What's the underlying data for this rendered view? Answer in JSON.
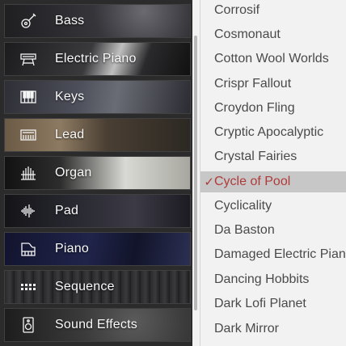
{
  "categories": [
    {
      "label": "Bass",
      "icon": "guitar-icon"
    },
    {
      "label": "Electric Piano",
      "icon": "electric-piano-icon"
    },
    {
      "label": "Keys",
      "icon": "keys-icon"
    },
    {
      "label": "Lead",
      "icon": "lead-synth-icon"
    },
    {
      "label": "Organ",
      "icon": "organ-icon"
    },
    {
      "label": "Pad",
      "icon": "waveform-icon"
    },
    {
      "label": "Piano",
      "icon": "grand-piano-icon"
    },
    {
      "label": "Sequence",
      "icon": "sequence-grid-icon"
    },
    {
      "label": "Sound Effects",
      "icon": "speaker-icon"
    }
  ],
  "presets": [
    {
      "name": "Corrosif"
    },
    {
      "name": "Cosmonaut"
    },
    {
      "name": "Cotton Wool Worlds"
    },
    {
      "name": "Crispr Fallout"
    },
    {
      "name": "Croydon Fling"
    },
    {
      "name": "Cryptic Apocalyptic"
    },
    {
      "name": "Crystal Fairies"
    },
    {
      "name": "Cycle of Pool",
      "check": "✓"
    },
    {
      "name": "Cyclicality"
    },
    {
      "name": "Da Baston"
    },
    {
      "name": "Damaged Electric Pian"
    },
    {
      "name": "Dancing Hobbits"
    },
    {
      "name": "Dark Lofi Planet"
    },
    {
      "name": "Dark Mirror"
    }
  ],
  "selected_preset_index": 7,
  "colors": {
    "selection_text": "#b03a3a",
    "selection_bg": "#c7c7c7",
    "list_text": "#4a4a4a"
  }
}
